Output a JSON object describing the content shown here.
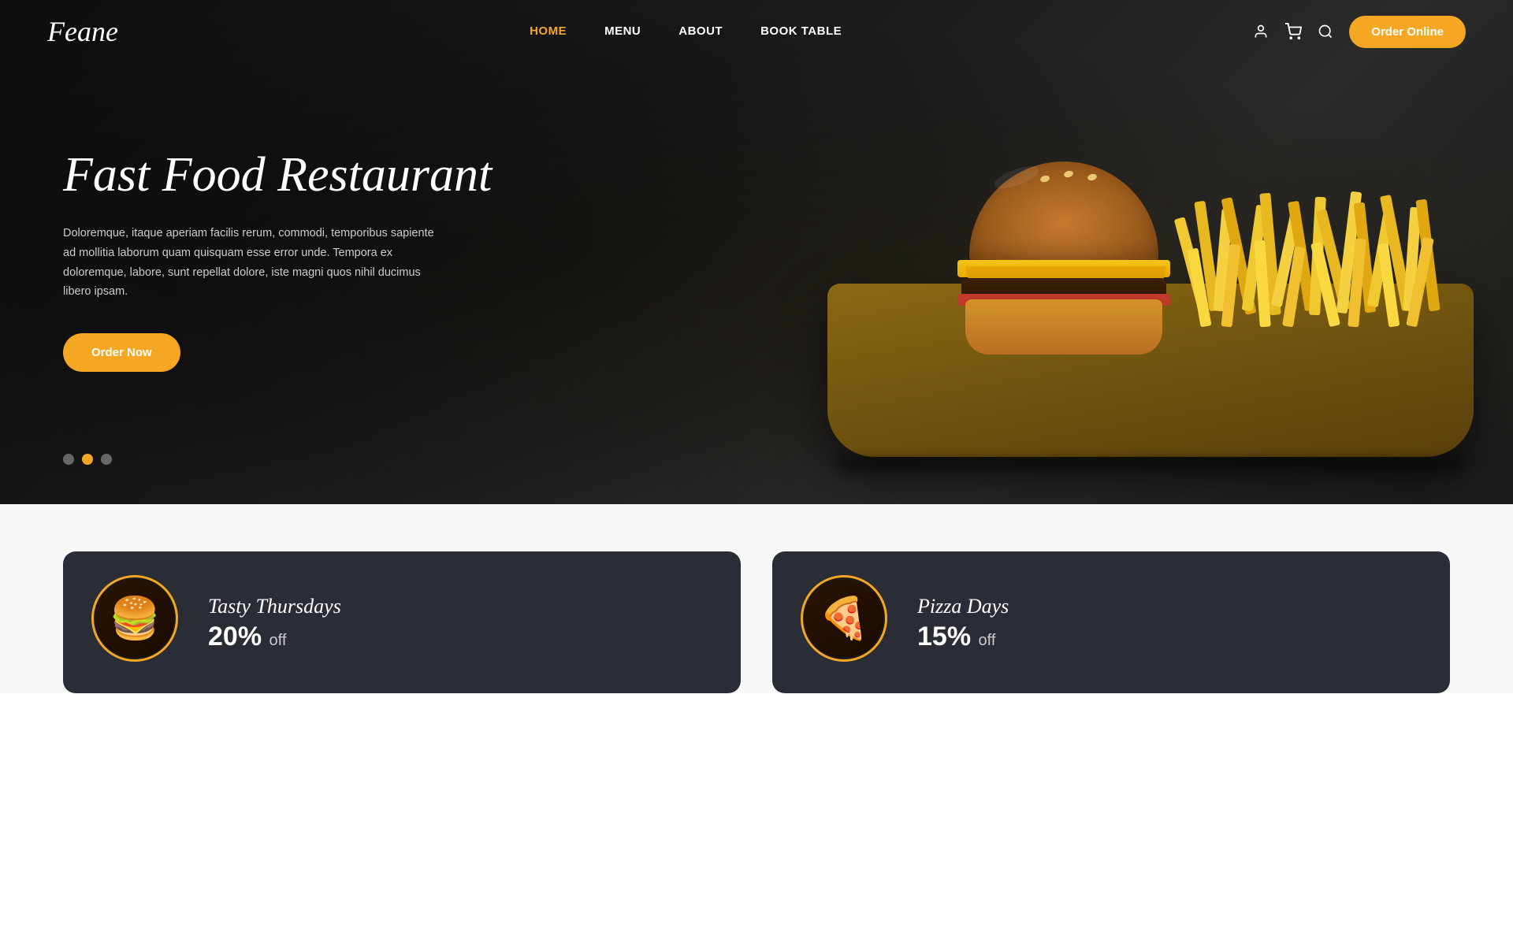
{
  "brand": {
    "name": "Feane"
  },
  "navbar": {
    "links": [
      {
        "id": "home",
        "label": "HOME",
        "active": true
      },
      {
        "id": "menu",
        "label": "MENU",
        "active": false
      },
      {
        "id": "about",
        "label": "ABOUT",
        "active": false
      },
      {
        "id": "book-table",
        "label": "BOOK TABLE",
        "active": false
      }
    ],
    "order_online_label": "Order Online"
  },
  "hero": {
    "title": "Fast Food Restaurant",
    "subtitle": "Doloremque, itaque aperiam facilis rerum, commodi, temporibus sapiente ad mollitia laborum quam quisquam esse error unde. Tempora ex doloremque, labore, sunt repellat dolore, iste magni quos nihil ducimus libero ipsam.",
    "cta_label": "Order Now",
    "dots": [
      {
        "id": "dot1",
        "active": false
      },
      {
        "id": "dot2",
        "active": true
      },
      {
        "id": "dot3",
        "active": false
      }
    ]
  },
  "promo": {
    "cards": [
      {
        "id": "tasty-thursdays",
        "name": "Tasty Thursdays",
        "discount": "20%",
        "off_label": "off",
        "food_type": "burger"
      },
      {
        "id": "pizza-days",
        "name": "Pizza Days",
        "discount": "15%",
        "off_label": "off",
        "food_type": "pizza"
      }
    ]
  },
  "colors": {
    "accent": "#f5a623",
    "dark": "#1a1a1a",
    "card_bg": "#2a2d35"
  },
  "icons": {
    "user": "👤",
    "cart": "🛒",
    "search": "🔍"
  }
}
